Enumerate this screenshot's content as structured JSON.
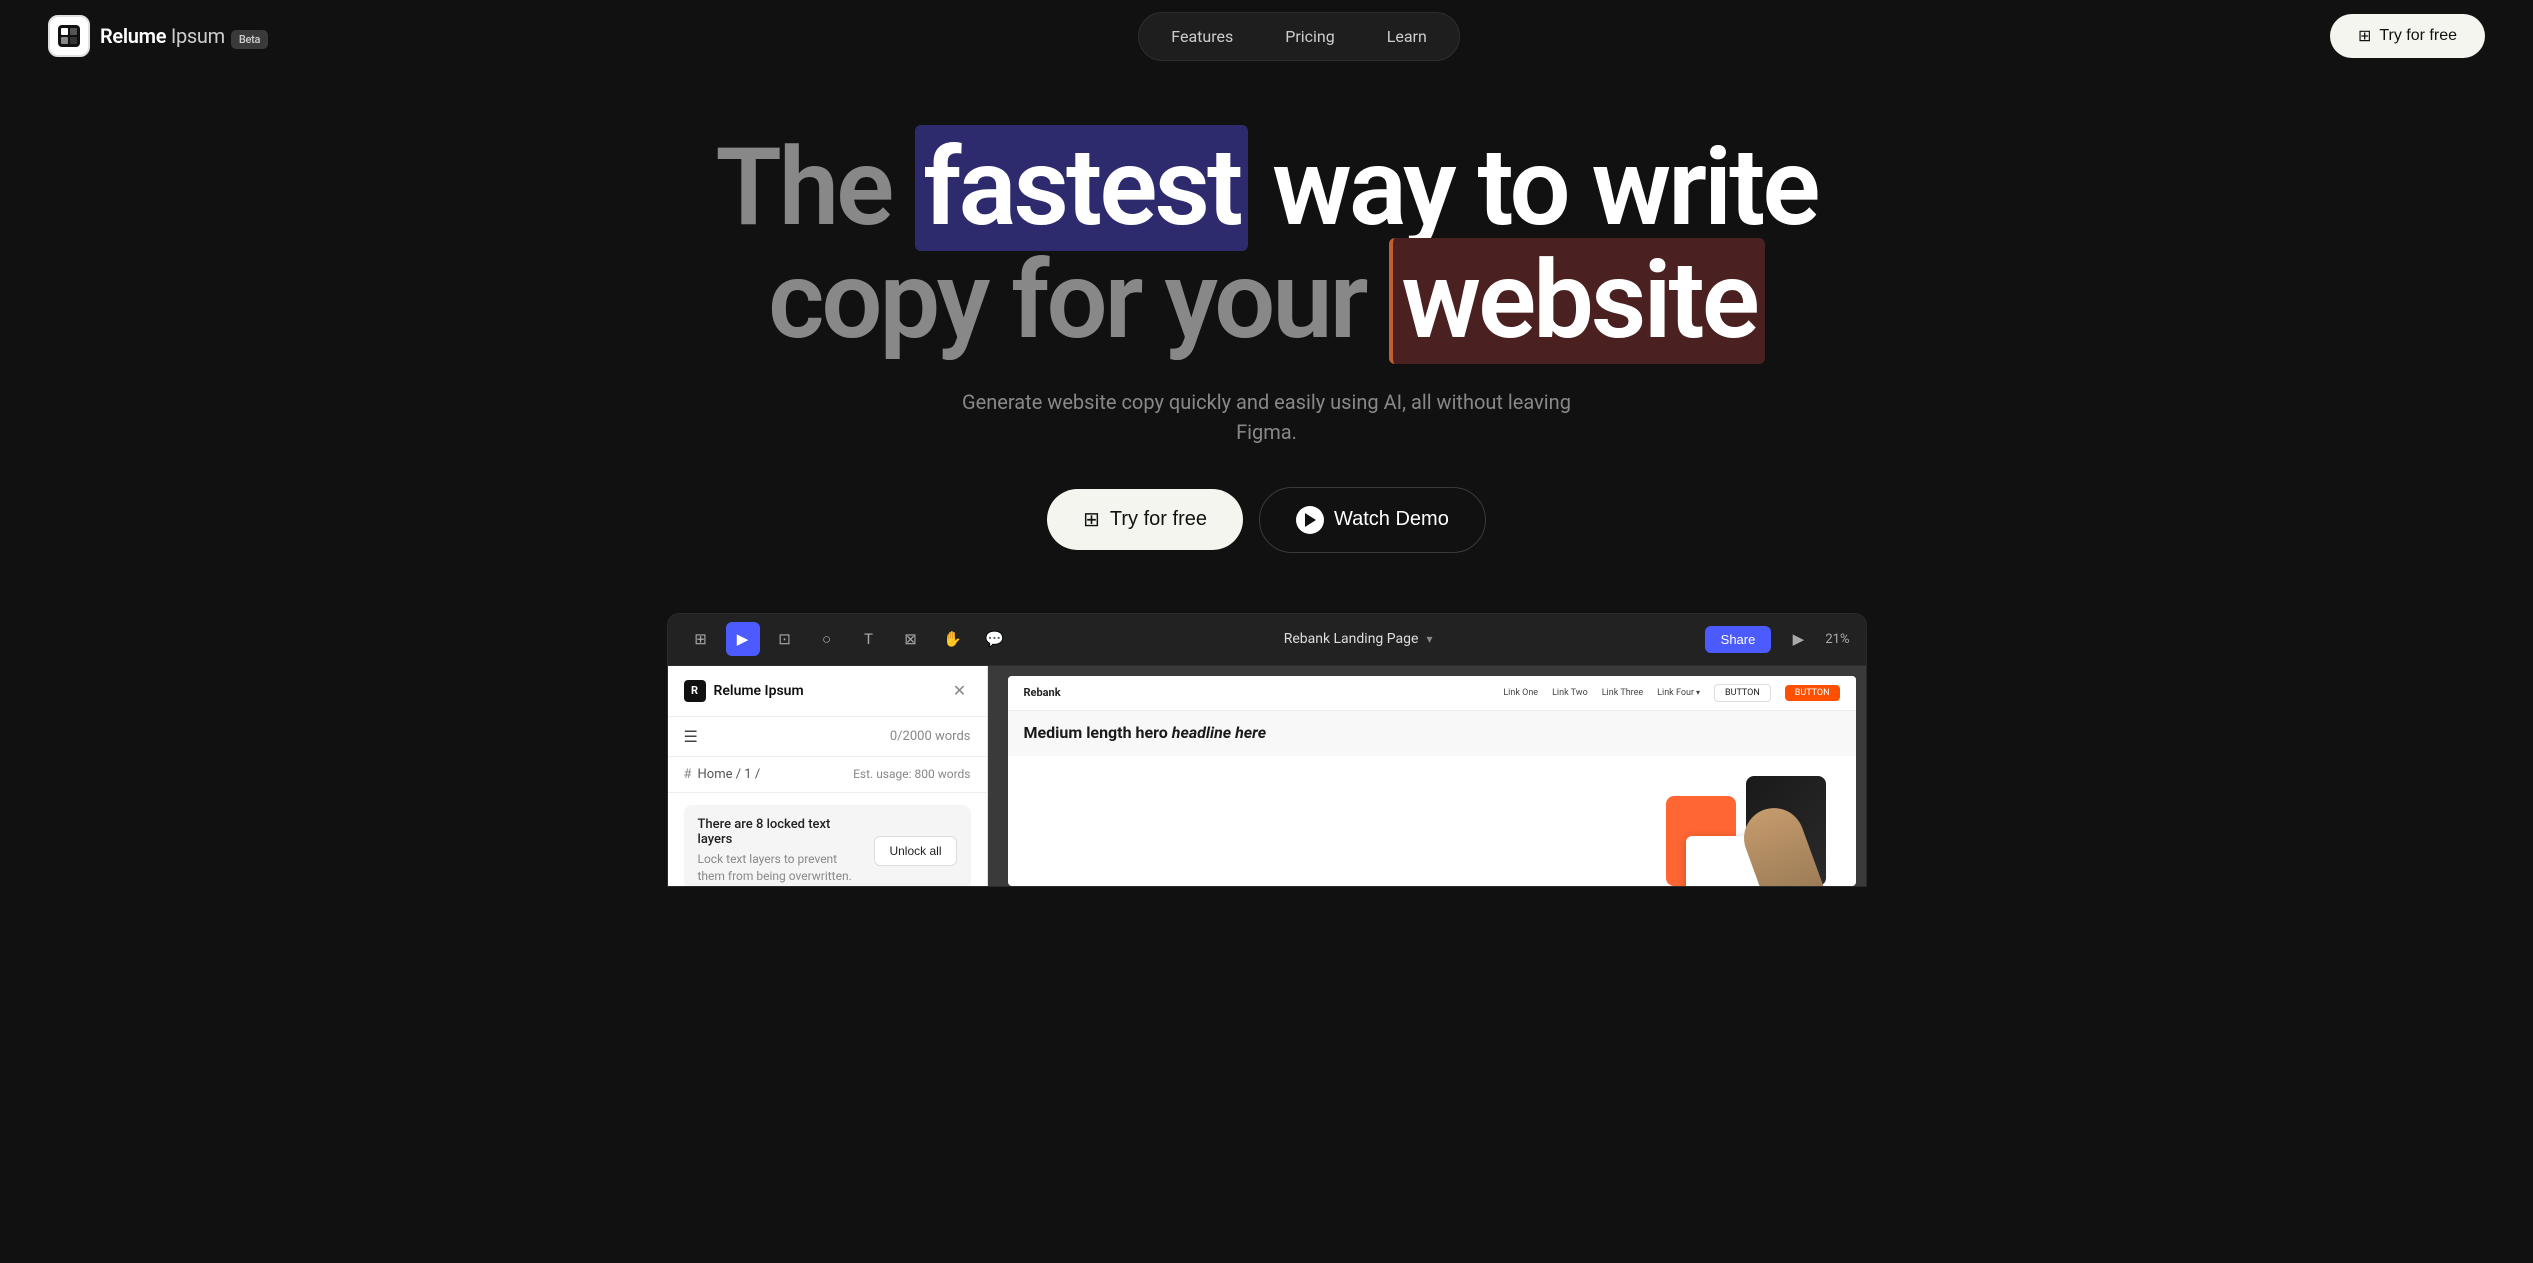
{
  "brand": {
    "logo_text": "Relume",
    "logo_ipsum": " Ipsum",
    "beta_label": "Beta"
  },
  "nav": {
    "features_label": "Features",
    "pricing_label": "Pricing",
    "learn_label": "Learn",
    "try_free_label": "Try for free",
    "grid_icon": "⊞"
  },
  "hero": {
    "title_part1": "The ",
    "title_fastest": "fastest",
    "title_part2": " way to write",
    "title_part3": "copy for your ",
    "title_website": "website",
    "subtitle": "Generate website copy quickly and easily using AI, all without leaving Figma.",
    "try_free_label": "Try for free",
    "watch_demo_label": "Watch Demo",
    "grid_icon": "⊞"
  },
  "figma": {
    "toolbar_title": "Rebank Landing Page",
    "share_label": "Share",
    "zoom_label": "21%",
    "tools": {
      "grid": "⊞",
      "cursor": "▶",
      "frame": "⊡",
      "shape": "○",
      "type": "T",
      "components": "⊠",
      "hand": "✋",
      "comment": "💬"
    }
  },
  "plugin": {
    "title": "Relume Ipsum",
    "close_icon": "✕",
    "menu_icon": "☰",
    "word_count": "0/2000 words",
    "breadcrumb": "Home / 1 /",
    "est_usage": "Est. usage: 800 words",
    "locked_title": "There are 8 locked text layers",
    "locked_desc": "Lock text layers to prevent them from being overwritten.",
    "unlock_all_label": "Unlock all"
  },
  "canvas": {
    "nav_logo": "Rebank",
    "link1": "Link One",
    "link2": "Link Two",
    "link3": "Link Three",
    "link4": "Link Four",
    "btn_label": "BUTTON",
    "btn_filled_label": "BUTTON",
    "hero_heading_line1": "Medium length hero",
    "hero_heading_line2": "headline here"
  }
}
